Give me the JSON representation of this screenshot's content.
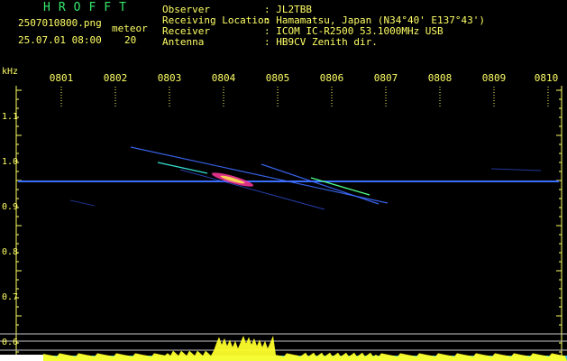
{
  "app": {
    "title": "HROFFT",
    "filename": "2507010800.png",
    "timestamp": "25.07.01 08:00",
    "meteor_label": "meteor",
    "meteor_count": "20"
  },
  "info": {
    "rows": [
      {
        "label": "Observer",
        "value": ": JL2TBB"
      },
      {
        "label": "Receiving Location",
        "value": ": Hamamatsu, Japan (N34°40' E137°43')"
      },
      {
        "label": "Receiver",
        "value": ": ICOM IC-R2500 53.1000MHz USB"
      },
      {
        "label": "Antenna",
        "value": ": HB9CV Zenith dir."
      }
    ]
  },
  "axis": {
    "unit": "kHz",
    "freq_ticks": [
      "1.1",
      "1.0",
      "0.9",
      "0.8",
      "0.7",
      "0.6"
    ],
    "time_ticks": [
      "0801",
      "0802",
      "0803",
      "0804",
      "0805",
      "0806",
      "0807",
      "0808",
      "0809",
      "0810"
    ]
  },
  "colors": {
    "background": "#000000",
    "text": "#ffff66",
    "title": "#37e86b",
    "carrier": "#2a5cff",
    "spectrum_cyan": "#27c9e6",
    "spectrum_yellow": "#ffff2a"
  }
}
